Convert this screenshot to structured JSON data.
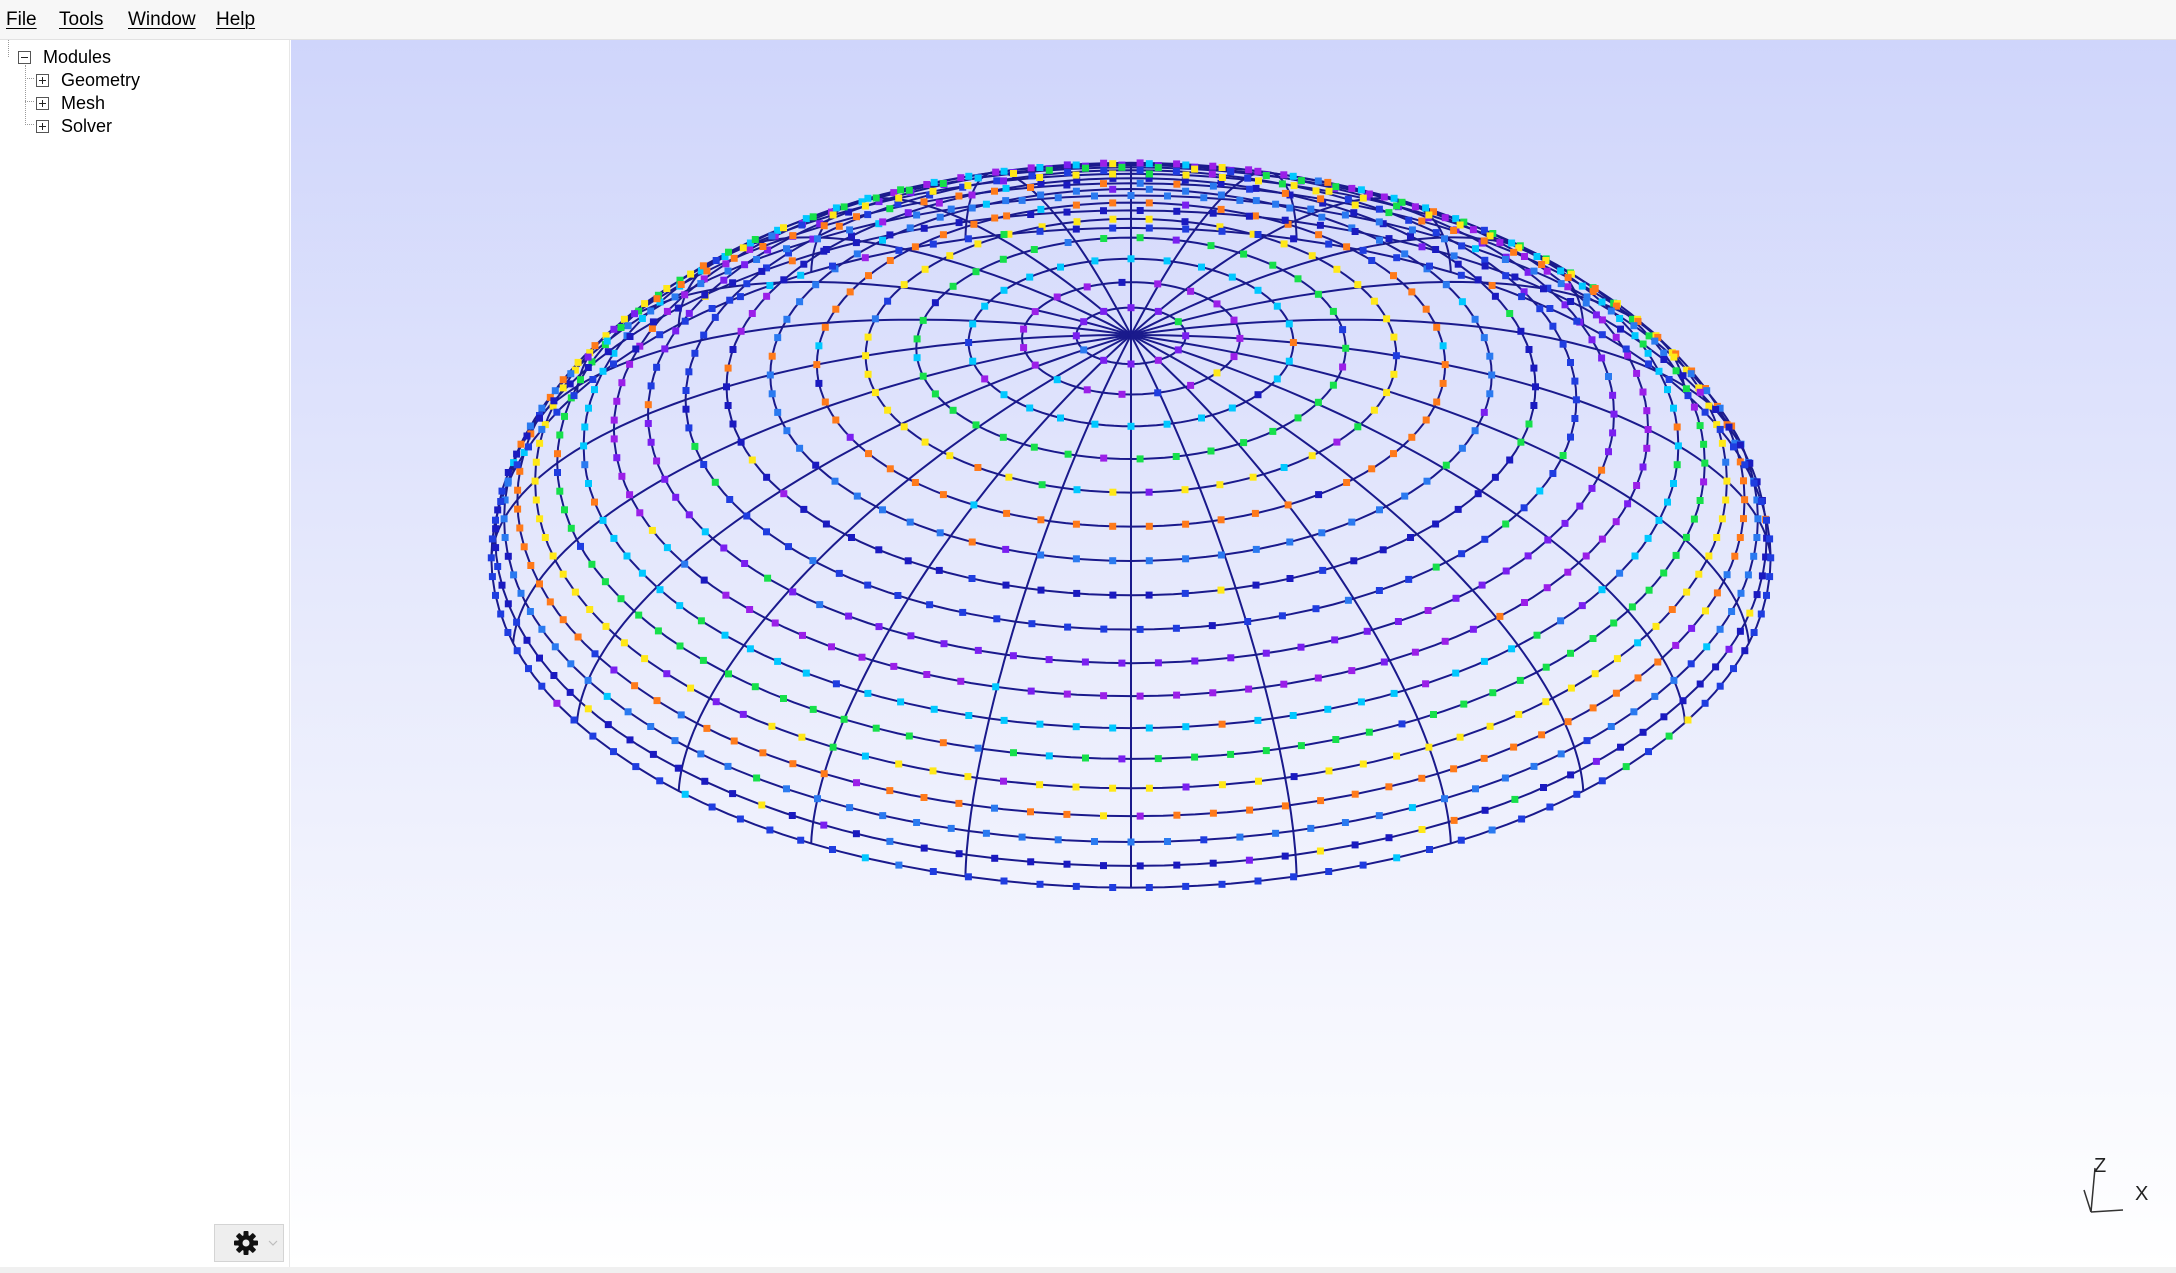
{
  "menubar": {
    "items": [
      {
        "label": "File"
      },
      {
        "label": "Tools"
      },
      {
        "label": "Window"
      },
      {
        "label": "Help"
      }
    ]
  },
  "tree": {
    "root": {
      "label": "Modules",
      "expanded": true
    },
    "children": [
      {
        "label": "Geometry",
        "expanded": false
      },
      {
        "label": "Mesh",
        "expanded": false
      },
      {
        "label": "Solver",
        "expanded": false
      }
    ]
  },
  "settings": {
    "icon": "gear-icon"
  },
  "viewport": {
    "background_top": "#cfd5fb",
    "background_bottom": "#ffffff",
    "line_color": "#1a1a8c",
    "node_colors": [
      "#1f3de0",
      "#7a1ff0",
      "#9b1fe8",
      "#00c8ff",
      "#16e04a",
      "#ffe817",
      "#ff7a1a",
      "#2a7af0",
      "#1a1ac0"
    ],
    "axes": {
      "z_label": "Z",
      "x_label": "X"
    }
  }
}
